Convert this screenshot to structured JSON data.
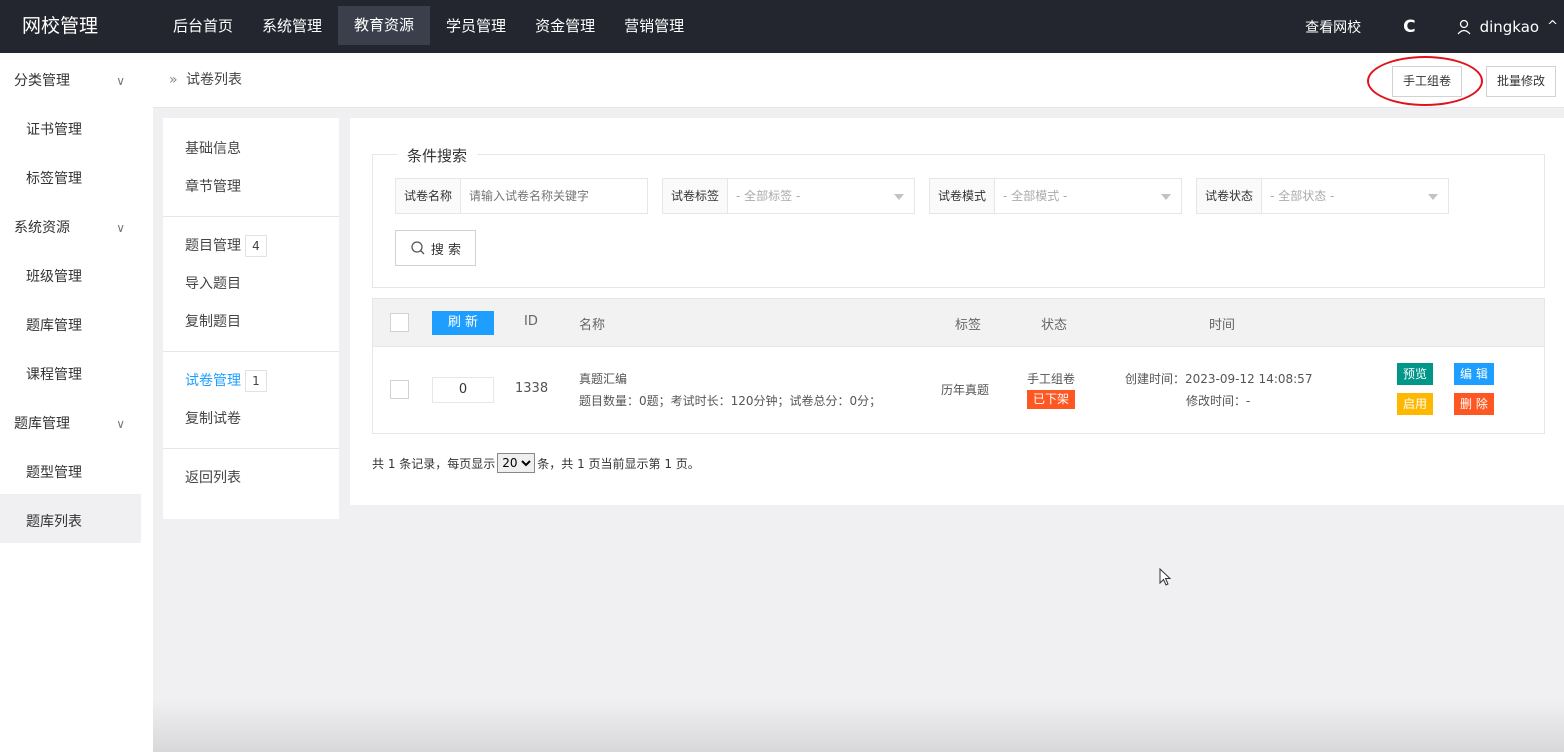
{
  "brand": "网校管理",
  "topnav": {
    "items": [
      "后台首页",
      "系统管理",
      "教育资源",
      "学员管理",
      "资金管理",
      "营销管理"
    ],
    "active_index": 2,
    "view_site": "查看网校",
    "refresh_icon": "C",
    "username": "dingkao",
    "caret": "^"
  },
  "sidebar": {
    "groups": [
      {
        "label": "分类管理",
        "chev": "∨",
        "items": [
          "证书管理",
          "标签管理"
        ]
      },
      {
        "label": "系统资源",
        "chev": "∨",
        "items": [
          "班级管理",
          "题库管理",
          "课程管理"
        ]
      },
      {
        "label": "题库管理",
        "chev": "∨",
        "items": [
          "题型管理",
          "题库列表"
        ]
      }
    ],
    "active_item": "题库列表"
  },
  "breadcrumb": {
    "sep": "»",
    "title": "试卷列表"
  },
  "header_buttons": {
    "manual": "手工组卷",
    "batch": "批量修改"
  },
  "innermenu": {
    "items": [
      {
        "label": "基础信息"
      },
      {
        "label": "章节管理"
      },
      {
        "label": "题目管理",
        "badge": "4"
      },
      {
        "label": "导入题目"
      },
      {
        "label": "复制题目"
      },
      {
        "label": "试卷管理",
        "badge": "1"
      },
      {
        "label": "复制试卷"
      },
      {
        "label": "返回列表"
      }
    ]
  },
  "search": {
    "legend": "条件搜索",
    "name_label": "试卷名称",
    "name_placeholder": "请输入试卷名称关键字",
    "tag_label": "试卷标签",
    "tag_value": "- 全部标签 -",
    "mode_label": "试卷模式",
    "mode_value": "- 全部模式 -",
    "status_label": "试卷状态",
    "status_value": "- 全部状态 -",
    "button": "搜 索"
  },
  "table": {
    "refresh": "刷 新",
    "headers": {
      "id": "ID",
      "name": "名称",
      "tag": "标签",
      "status": "状态",
      "time": "时间"
    },
    "rows": [
      {
        "sort": "0",
        "id": "1338",
        "name": "真题汇编",
        "detail": "题目数量：0题；考试时长：120分钟；试卷总分：0分；",
        "tag": "历年真题",
        "mode": "手工组卷",
        "state": "已下架",
        "created": "创建时间：2023-09-12 14:08:57",
        "modified": "修改时间：-",
        "actions": {
          "preview": "预览",
          "edit": "编 辑",
          "enable": "启用",
          "delete": "删 除"
        }
      }
    ]
  },
  "pager": {
    "prefix": "共 1 条记录，每页显示",
    "page_size": "20",
    "suffix": "条，共 1 页当前显示第 1 页。"
  },
  "colors": {
    "topbar": "#23262e",
    "blue": "#1e9fff",
    "green": "#009688",
    "orange": "#ffb800",
    "red": "#ff5722",
    "annotation": "#e2121b"
  }
}
